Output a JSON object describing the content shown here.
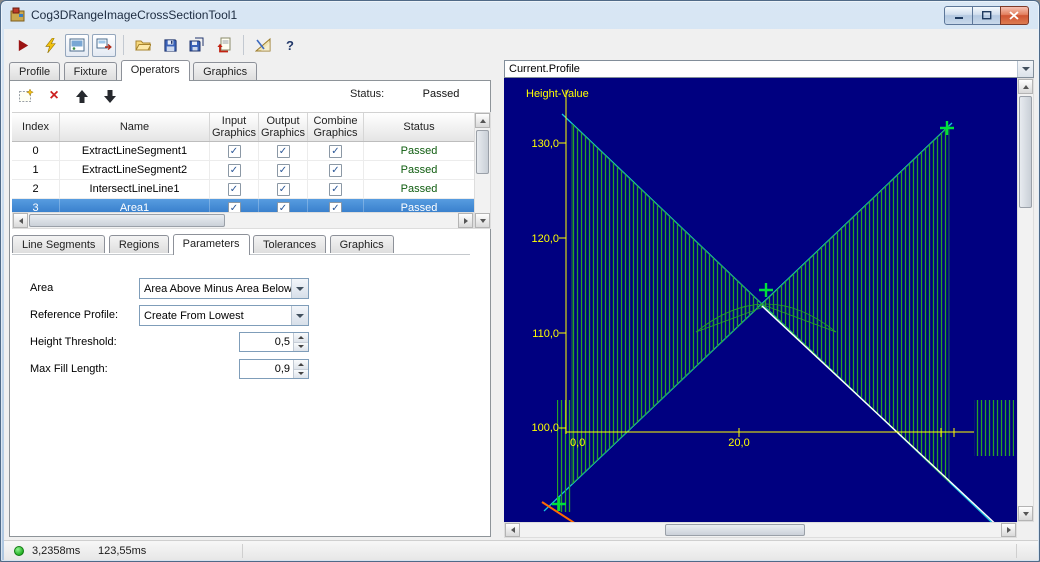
{
  "window": {
    "title": "Cog3DRangeImageCrossSectionTool1"
  },
  "icons": {
    "check": "✓",
    "delete": "×",
    "help": "?"
  },
  "toolbar": {
    "items": [
      "run",
      "trigger",
      "show-image",
      "show-last-run",
      "open",
      "save",
      "save-as",
      "import",
      "setup",
      "help"
    ]
  },
  "main_tabs": [
    {
      "label": "Profile",
      "active": false
    },
    {
      "label": "Fixture",
      "active": false
    },
    {
      "label": "Operators",
      "active": true
    },
    {
      "label": "Graphics",
      "active": false
    }
  ],
  "operators": {
    "status_label": "Status:",
    "status_value": "Passed",
    "table": {
      "headers": [
        "Index",
        "Name",
        "Input Graphics",
        "Output Graphics",
        "Combine Graphics",
        "Status"
      ],
      "rows": [
        {
          "index": "0",
          "name": "ExtractLineSegment1",
          "input": true,
          "output": true,
          "combine": true,
          "status": "Passed",
          "selected": false
        },
        {
          "index": "1",
          "name": "ExtractLineSegment2",
          "input": true,
          "output": true,
          "combine": true,
          "status": "Passed",
          "selected": false
        },
        {
          "index": "2",
          "name": "IntersectLineLine1",
          "input": true,
          "output": true,
          "combine": true,
          "status": "Passed",
          "selected": false
        },
        {
          "index": "3",
          "name": "Area1",
          "input": true,
          "output": true,
          "combine": true,
          "status": "Passed",
          "selected": true
        }
      ]
    }
  },
  "param_tabs": [
    {
      "label": "Line Segments",
      "active": false
    },
    {
      "label": "Regions",
      "active": false
    },
    {
      "label": "Parameters",
      "active": true
    },
    {
      "label": "Tolerances",
      "active": false
    },
    {
      "label": "Graphics",
      "active": false
    }
  ],
  "parameters": {
    "area_label": "Area",
    "area_value": "Area Above Minus Area Below",
    "reference_label": "Reference Profile:",
    "reference_value": "Create From Lowest",
    "height_threshold_label": "Height Threshold:",
    "height_threshold_value": "0,5",
    "max_fill_length_label": "Max Fill Length:",
    "max_fill_length_value": "0,9"
  },
  "profile_view": {
    "selector_value": "Current.Profile",
    "axis_title": "Height-Value",
    "y_ticks": [
      "130,0",
      "120,0",
      "110,0",
      "100,0"
    ],
    "x_ticks": [
      "0,0",
      "20,0"
    ]
  },
  "status_bar": {
    "time_primary": "3,2358ms",
    "time_secondary": "123,55ms"
  }
}
